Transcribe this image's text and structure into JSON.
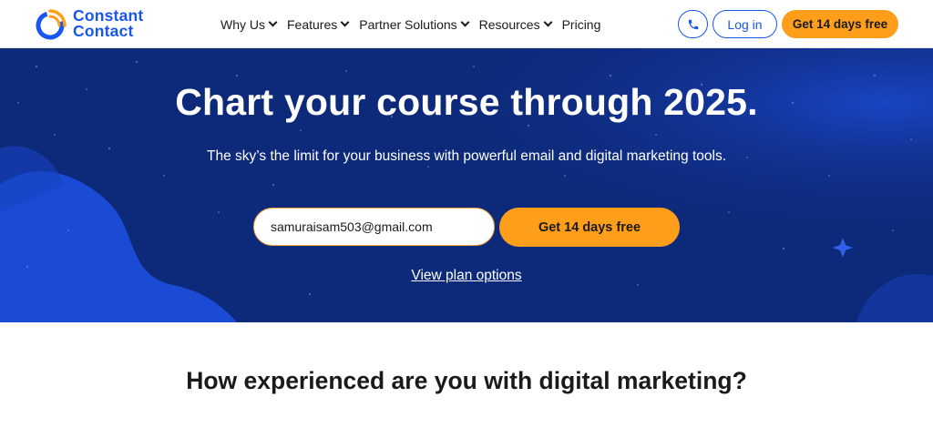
{
  "brand": {
    "line1": "Constant",
    "line2": "Contact",
    "colors": {
      "primary": "#1856ed",
      "accent": "#ff9e1b",
      "hero_bg": "#0d2a7a"
    },
    "icon": "constant-contact-logo-icon"
  },
  "nav": {
    "items": [
      {
        "label": "Why Us",
        "has_dropdown": true
      },
      {
        "label": "Features",
        "has_dropdown": true
      },
      {
        "label": "Partner Solutions",
        "has_dropdown": true
      },
      {
        "label": "Resources",
        "has_dropdown": true
      },
      {
        "label": "Pricing",
        "has_dropdown": false
      }
    ],
    "phone_icon": "phone-icon",
    "login_label": "Log in",
    "cta_label": "Get 14 days free"
  },
  "hero": {
    "title": "Chart your course through 2025.",
    "subtitle": "The sky’s the limit for your business with powerful email and digital marketing tools.",
    "email_value": "samuraisam503@gmail.com",
    "cta_label": "Get 14 days free",
    "plan_link": "View plan options"
  },
  "section": {
    "question": "How experienced are you with digital marketing?"
  }
}
